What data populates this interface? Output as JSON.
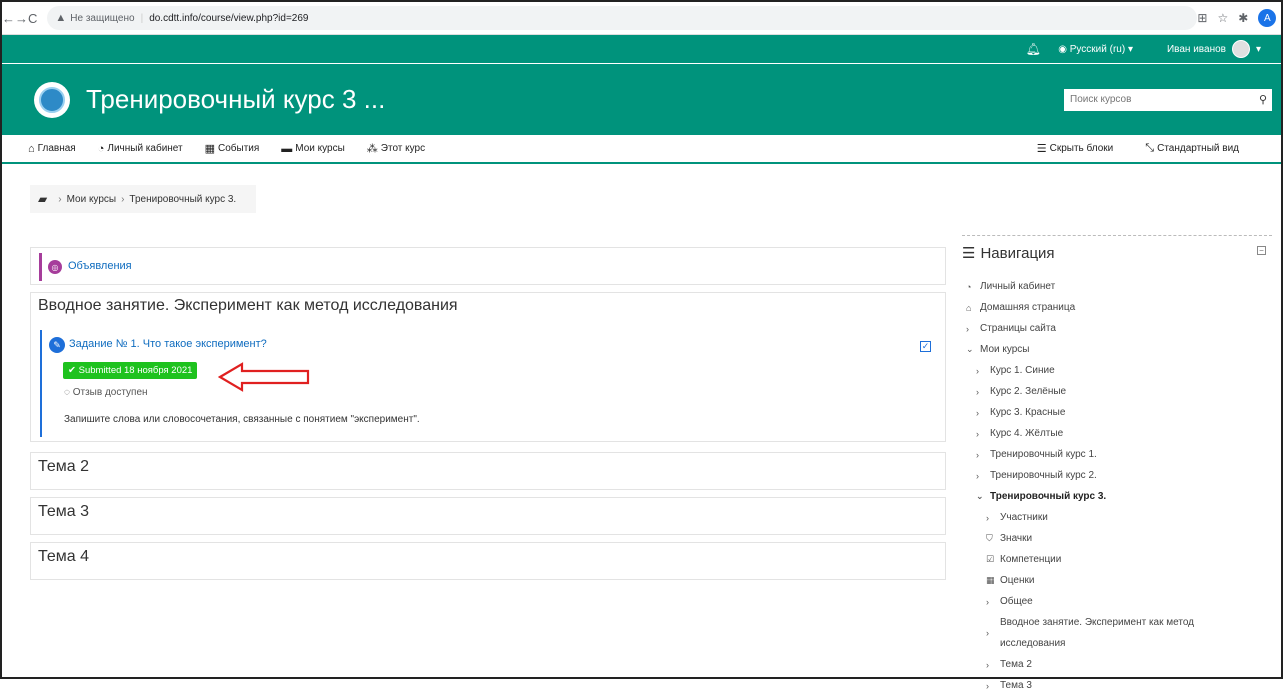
{
  "browser": {
    "back": "←",
    "forward": "→",
    "reload": "C",
    "security_label": "Не защищено",
    "url": "do.cdtt.info/course/view.php?id=269",
    "profile_initial": "A"
  },
  "topbar": {
    "language": "Русский (ru) ▾",
    "user_name": "Иван иванов",
    "user_menu_caret": "▾"
  },
  "header": {
    "course_title": "Тренировочный курс 3 ...",
    "search_placeholder": "Поиск курсов"
  },
  "menu": {
    "items": [
      {
        "icon": "home-icon",
        "label": "Главная"
      },
      {
        "icon": "dashboard-icon",
        "label": "Личный кабинет"
      },
      {
        "icon": "calendar-icon",
        "label": "События"
      },
      {
        "icon": "briefcase-icon",
        "label": "Мои курсы"
      },
      {
        "icon": "sitemap-icon",
        "label": "Этот курс"
      }
    ],
    "hide_blocks": "Скрыть блоки",
    "standard_view": "Стандартный вид"
  },
  "breadcrumb": {
    "items": [
      "Мои курсы",
      "Тренировочный курс 3."
    ]
  },
  "course": {
    "announcements_label": "Объявления",
    "section1": {
      "title": "Вводное занятие. Эксперимент как метод исследования",
      "activity": {
        "title": "Задание № 1. Что такое эксперимент?",
        "status": "Submitted 18 ноября 2021",
        "feedback": "Отзыв доступен",
        "description": "Запишите слова или словосочетания, связанные с понятием \"эксперимент\"."
      }
    },
    "topics": [
      "Тема 2",
      "Тема 3",
      "Тема 4"
    ]
  },
  "navigation": {
    "title": "Навигация",
    "items": [
      {
        "label": "Личный кабинет",
        "icon": "dashboard-icon"
      },
      {
        "label": "Домашняя страница",
        "icon": "home-icon"
      },
      {
        "label": "Страницы сайта",
        "icon": "chevron-right-icon"
      },
      {
        "label": "Мои курсы",
        "icon": "chevron-down-icon"
      },
      {
        "label": "Курс 1. Синие",
        "icon": "chevron-right-icon"
      },
      {
        "label": "Курс 2. Зелёные",
        "icon": "chevron-right-icon"
      },
      {
        "label": "Курс 3. Красные",
        "icon": "chevron-right-icon"
      },
      {
        "label": "Курс 4. Жёлтые",
        "icon": "chevron-right-icon"
      },
      {
        "label": "Тренировочный курс 1.",
        "icon": "chevron-right-icon"
      },
      {
        "label": "Тренировочный курс 2.",
        "icon": "chevron-right-icon"
      },
      {
        "label": "Тренировочный курс 3.",
        "icon": "chevron-down-icon"
      },
      {
        "label": "Участники",
        "icon": "chevron-right-icon"
      },
      {
        "label": "Значки",
        "icon": "shield-icon"
      },
      {
        "label": "Компетенции",
        "icon": "checkbox-icon"
      },
      {
        "label": "Оценки",
        "icon": "table-icon"
      },
      {
        "label": "Общее",
        "icon": "chevron-right-icon"
      },
      {
        "label": "Вводное занятие. Эксперимент как метод исследования",
        "icon": "chevron-right-icon"
      },
      {
        "label": "Тема 2",
        "icon": "chevron-right-icon"
      },
      {
        "label": "Тема 3",
        "icon": "chevron-right-icon"
      }
    ]
  },
  "colors": {
    "brand": "#00937c",
    "link": "#0f6cbf",
    "submitted": "#1ec21e",
    "annotation_arrow": "#e02020"
  }
}
